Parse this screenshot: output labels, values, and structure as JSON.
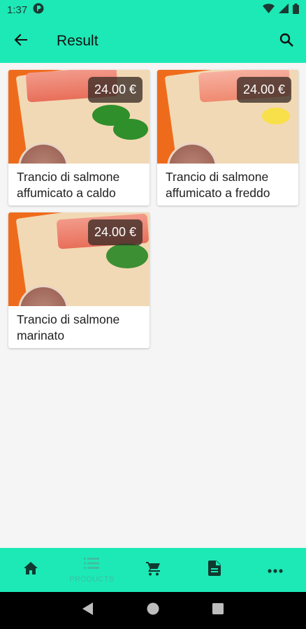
{
  "status_bar": {
    "time": "1:37"
  },
  "app_bar": {
    "title": "Result"
  },
  "products": [
    {
      "name": "Trancio di salmone affumicato a caldo",
      "price": "24.00 €"
    },
    {
      "name": "Trancio di salmone affumicato a freddo",
      "price": "24.00 €"
    },
    {
      "name": "Trancio di salmone marinato",
      "price": "24.00 €"
    }
  ],
  "bottom_nav": {
    "items": [
      {
        "icon": "home-icon",
        "label": ""
      },
      {
        "icon": "list-icon",
        "label": "PRODUCTS"
      },
      {
        "icon": "cart-icon",
        "label": ""
      },
      {
        "icon": "document-icon",
        "label": ""
      },
      {
        "icon": "more-icon",
        "label": ""
      }
    ]
  },
  "colors": {
    "accent": "#1de9b6",
    "background": "#f5f5f5",
    "orange": "#ef6b1c"
  }
}
